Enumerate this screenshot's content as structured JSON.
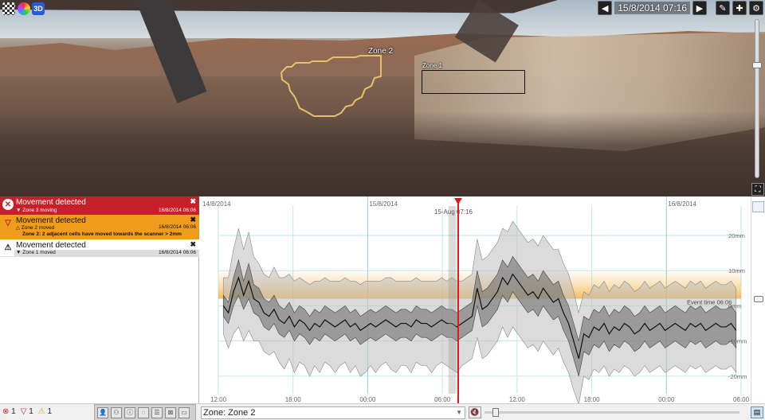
{
  "scene": {
    "zones": [
      {
        "label": "Zone 2"
      },
      {
        "label": "Zone 1"
      }
    ]
  },
  "toolbar": {
    "datetime": "15/8/2014 07:16",
    "prev_icon": "arrow-left-icon",
    "next_icon": "arrow-right-icon",
    "edit_icon": "pencil-icon",
    "add_icon": "plus-icon",
    "settings_icon": "gear-icon"
  },
  "alerts": [
    {
      "title": "Movement detected",
      "sub": "▼ Zone 3 moving",
      "time": "16/8/2014 06:06",
      "level": "red"
    },
    {
      "title": "Movement detected",
      "sub": "△ Zone 2 moved",
      "time": "16/8/2014 06:06",
      "detail": "Zone 2: 2 adjacent cells have moved towards the scanner > 2mm",
      "level": "orange"
    },
    {
      "title": "Movement detected",
      "sub": "▼ Zone 1 moved",
      "time": "16/8/2014 06:06",
      "level": "white"
    }
  ],
  "counters": {
    "red": "1",
    "orange": "1",
    "yellow": "1"
  },
  "zone_select": {
    "value": "Zone: Zone 2"
  },
  "colors": {
    "red": "#c8202a",
    "orange": "#ef9b1b",
    "zone_outline": "#e7c069",
    "cursor": "#e01818"
  },
  "chart_data": {
    "type": "line",
    "date_labels": [
      "14/8/2014",
      "15/8/2014",
      "16/8/2014"
    ],
    "cursor_label": "15-Aug 07:16",
    "event_label": "Event time 06:06",
    "x_ticks": [
      "12:00",
      "18:00",
      "00:00",
      "06:00",
      "12:00",
      "18:00",
      "00:00",
      "06:00"
    ],
    "y_ticks": [
      "20mm",
      "10mm",
      "0mm",
      "-10mm",
      "-20mm"
    ],
    "ylim": [
      -25,
      27
    ],
    "x_range_hours": [
      0,
      42
    ],
    "cursor_hour": 19.27,
    "threshold_band": [
      2,
      10
    ],
    "mean": [
      0,
      -2,
      4,
      8,
      3,
      7,
      2,
      1,
      -2,
      -3,
      -1,
      -4,
      -5,
      -3,
      -6,
      -4,
      -5,
      -7,
      -5,
      -6,
      -4,
      -5,
      -6,
      -5,
      -4,
      -6,
      -5,
      -7,
      -6,
      -5,
      -6,
      -5,
      -4,
      -5,
      -6,
      -5,
      -5,
      -6,
      -4,
      -5,
      -5,
      -6,
      -5,
      -4,
      -5,
      -5,
      -6,
      -5,
      -4,
      -3,
      5,
      -1,
      0,
      2,
      4,
      8,
      6,
      9,
      7,
      5,
      3,
      4,
      2,
      5,
      3,
      1,
      2,
      -2,
      -5,
      -10,
      -15,
      -8,
      -9,
      -6,
      -7,
      -5,
      -8,
      -6,
      -7,
      -5,
      -6,
      -8,
      -7,
      -5,
      -7,
      -6,
      -5,
      -7,
      -6,
      -5,
      -6,
      -7,
      -5,
      -6,
      -5,
      -7,
      -6,
      -5,
      -6,
      -6,
      -5,
      -7
    ],
    "inner_band": [
      3,
      3,
      4,
      5,
      4,
      5,
      4,
      4,
      4,
      4,
      4,
      4,
      4,
      4,
      4,
      4,
      4,
      4,
      4,
      4,
      4,
      4,
      4,
      4,
      4,
      4,
      4,
      4,
      4,
      4,
      4,
      4,
      4,
      4,
      4,
      4,
      4,
      4,
      4,
      4,
      4,
      4,
      4,
      4,
      4,
      4,
      4,
      4,
      4,
      4,
      5,
      5,
      5,
      5,
      5,
      5,
      5,
      5,
      5,
      5,
      5,
      5,
      5,
      5,
      5,
      5,
      5,
      5,
      5,
      5,
      5,
      5,
      5,
      5,
      5,
      5,
      5,
      5,
      5,
      5,
      5,
      5,
      5,
      5,
      5,
      5,
      5,
      5,
      5,
      5,
      5,
      5,
      5,
      5,
      5,
      5,
      5,
      5,
      5,
      5,
      5,
      5
    ],
    "outer_band": [
      8,
      10,
      12,
      14,
      13,
      14,
      12,
      11,
      11,
      11,
      12,
      12,
      13,
      12,
      13,
      12,
      12,
      13,
      12,
      13,
      12,
      12,
      13,
      12,
      12,
      13,
      12,
      13,
      13,
      12,
      13,
      12,
      12,
      13,
      13,
      12,
      12,
      13,
      12,
      12,
      12,
      13,
      12,
      12,
      12,
      13,
      13,
      12,
      12,
      12,
      14,
      14,
      14,
      14,
      14,
      14,
      15,
      15,
      15,
      15,
      15,
      15,
      15,
      15,
      15,
      15,
      14,
      14,
      14,
      14,
      13,
      12,
      12,
      12,
      12,
      12,
      12,
      12,
      12,
      12,
      12,
      12,
      12,
      12,
      12,
      12,
      12,
      12,
      12,
      12,
      12,
      12,
      12,
      12,
      12,
      12,
      12,
      12,
      12,
      12,
      12,
      12
    ]
  }
}
